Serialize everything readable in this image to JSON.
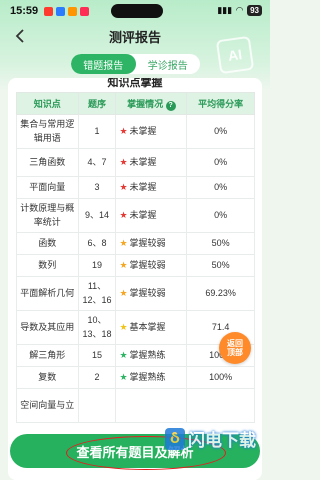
{
  "status_bar": {
    "time": "15:59",
    "battery": "93"
  },
  "header": {
    "title": "测评报告",
    "ai_badge": "AI"
  },
  "tabs": [
    {
      "label": "错题报告",
      "active": true
    },
    {
      "label": "学诊报告",
      "active": false
    }
  ],
  "card_title": "知识点掌握",
  "table": {
    "headers": [
      "知识点",
      "题序",
      "掌握情况",
      "平均得分率"
    ],
    "help_icon": "?",
    "rows": [
      {
        "topic": "集合与常用逻辑用语",
        "questions": "1",
        "status": "未掌握",
        "status_color": "#e53935",
        "rate": "0%"
      },
      {
        "topic": "三角函数",
        "questions": "4、7",
        "status": "未掌握",
        "status_color": "#e53935",
        "rate": "0%"
      },
      {
        "topic": "平面向量",
        "questions": "3",
        "status": "未掌握",
        "status_color": "#e53935",
        "rate": "0%"
      },
      {
        "topic": "计数原理与概率统计",
        "questions": "9、14",
        "status": "未掌握",
        "status_color": "#e53935",
        "rate": "0%"
      },
      {
        "topic": "函数",
        "questions": "6、8",
        "status": "掌握较弱",
        "status_color": "#f5a623",
        "rate": "50%"
      },
      {
        "topic": "数列",
        "questions": "19",
        "status": "掌握较弱",
        "status_color": "#f5a623",
        "rate": "50%"
      },
      {
        "topic": "平面解析几何",
        "questions": "11、12、16",
        "status": "掌握较弱",
        "status_color": "#f5a623",
        "rate": "69.23%"
      },
      {
        "topic": "导数及其应用",
        "questions": "10、13、18",
        "status": "基本掌握",
        "status_color": "#f0c419",
        "rate": "71.4"
      },
      {
        "topic": "解三角形",
        "questions": "15",
        "status": "掌握熟练",
        "status_color": "#2db464",
        "rate": "100%"
      },
      {
        "topic": "复数",
        "questions": "2",
        "status": "掌握熟练",
        "status_color": "#2db464",
        "rate": "100%"
      },
      {
        "topic": "空间向量与立",
        "questions": "",
        "status": "",
        "status_color": "#2db464",
        "rate": ""
      }
    ]
  },
  "back_to_top": "返回顶部",
  "bottom_button": "查看所有题目及解析",
  "watermark": {
    "logo": "Ⴢ",
    "text": "闪电下载"
  }
}
